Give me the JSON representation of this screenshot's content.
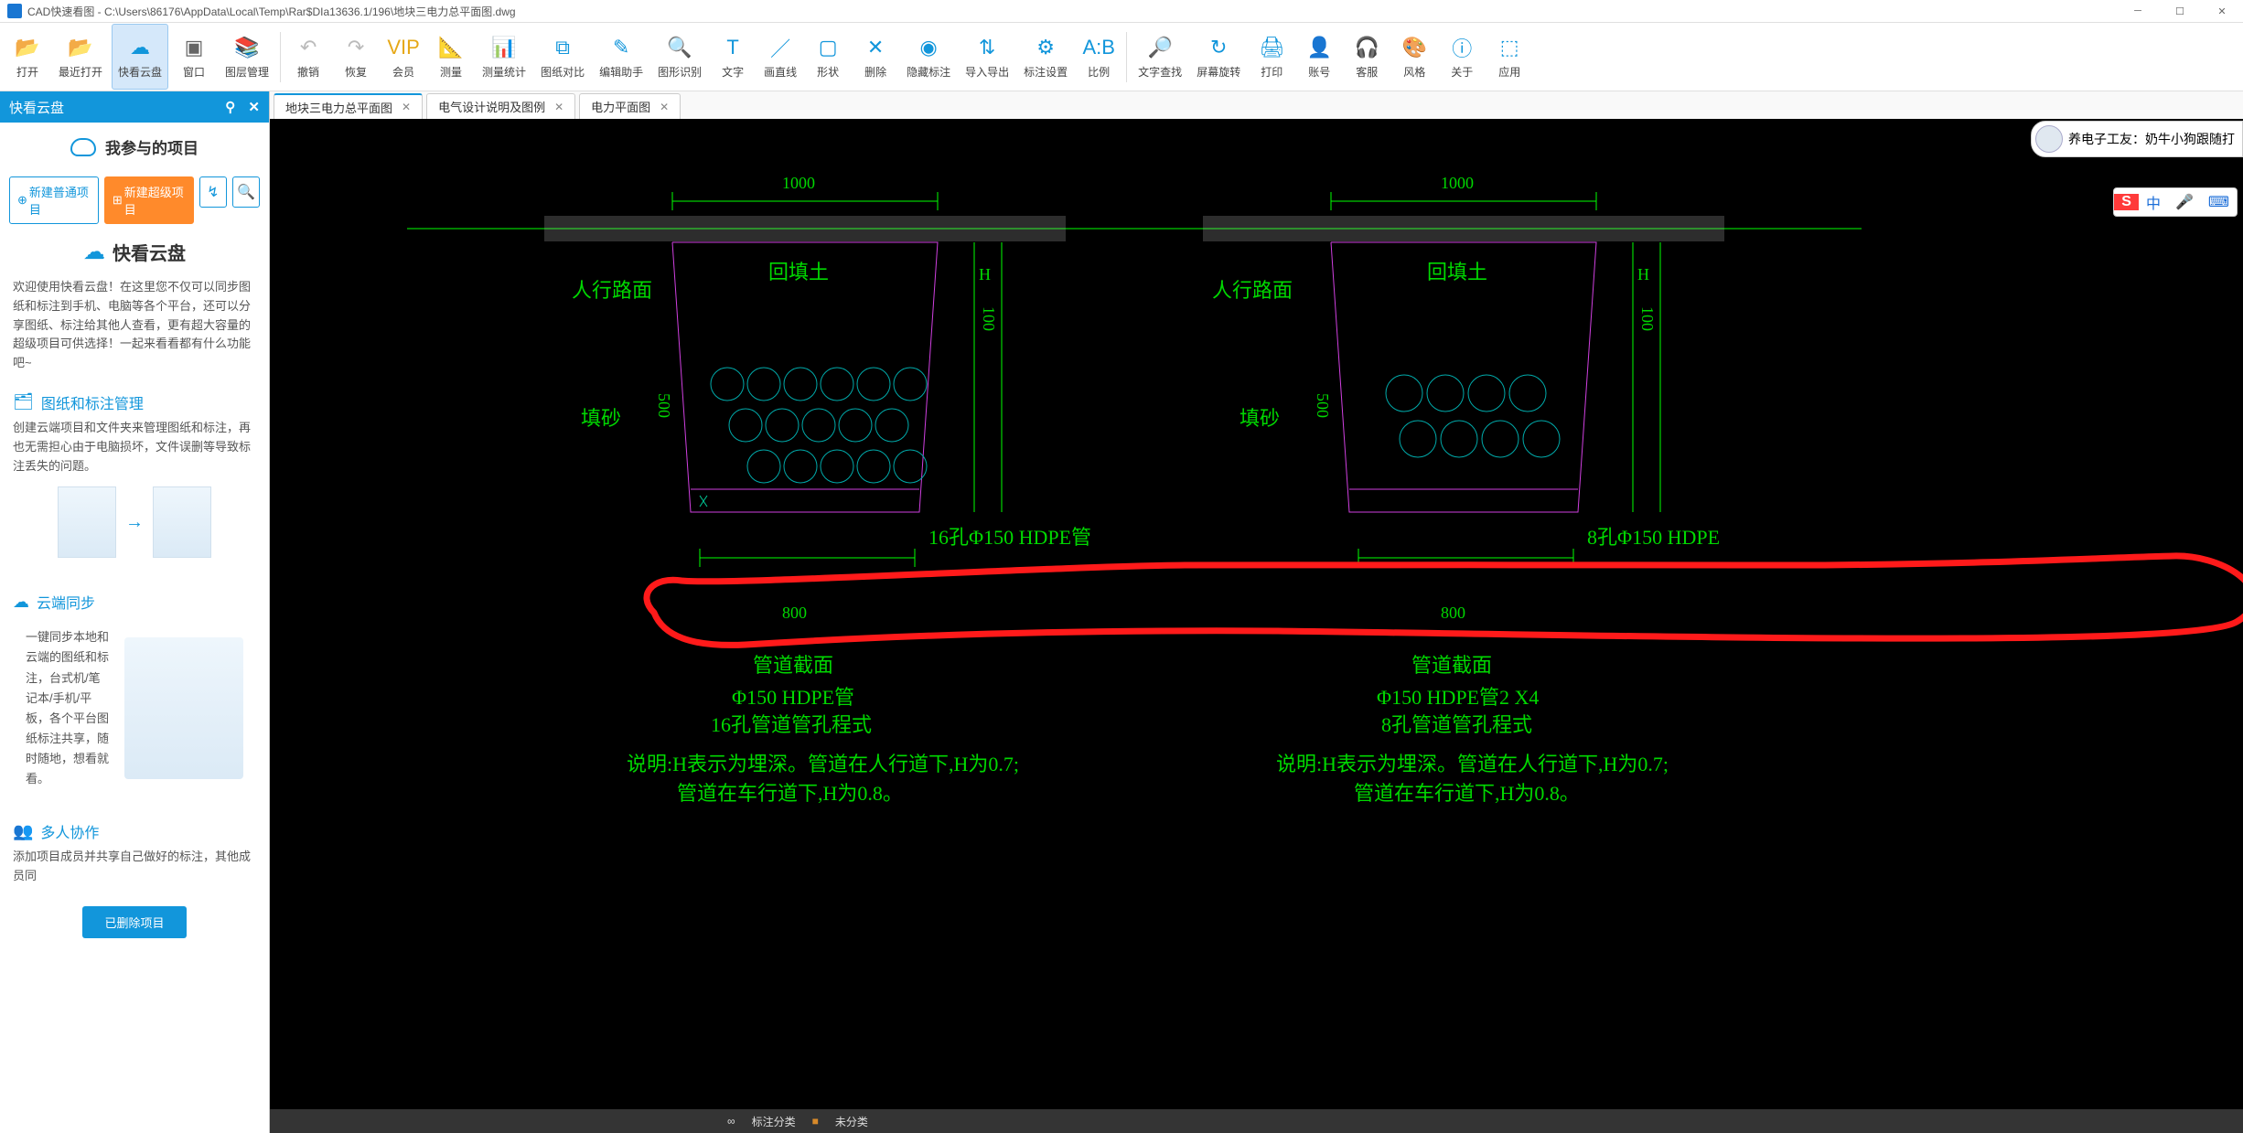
{
  "title": "CAD快速看图 - C:\\Users\\86176\\AppData\\Local\\Temp\\Rar$DIa13636.1/196\\地块三电力总平面图.dwg",
  "wincontrols": {
    "min": "─",
    "max": "☐",
    "close": "✕"
  },
  "toolbar": [
    {
      "label": "打开",
      "icon": "📂",
      "color": "#1296db"
    },
    {
      "label": "最近打开",
      "icon": "📂",
      "color": "#1296db"
    },
    {
      "label": "快看云盘",
      "icon": "☁",
      "color": "#1296db",
      "hl": true
    },
    {
      "label": "窗口",
      "icon": "▣",
      "color": "#666"
    },
    {
      "label": "图层管理",
      "icon": "📚",
      "color": "#1296db"
    },
    {
      "sep": true
    },
    {
      "label": "撤销",
      "icon": "↶",
      "color": "#bbb"
    },
    {
      "label": "恢复",
      "icon": "↷",
      "color": "#bbb"
    },
    {
      "label": "会员",
      "icon": "VIP",
      "color": "#e6a817"
    },
    {
      "label": "测量",
      "icon": "📐",
      "color": "#1296db"
    },
    {
      "label": "测量统计",
      "icon": "📊",
      "color": "#1296db"
    },
    {
      "label": "图纸对比",
      "icon": "⧉",
      "color": "#1296db"
    },
    {
      "label": "编辑助手",
      "icon": "✎",
      "color": "#1296db"
    },
    {
      "label": "图形识别",
      "icon": "🔍",
      "color": "#1296db"
    },
    {
      "label": "文字",
      "icon": "T",
      "color": "#1296db"
    },
    {
      "label": "画直线",
      "icon": "／",
      "color": "#1296db"
    },
    {
      "label": "形状",
      "icon": "▢",
      "color": "#1296db"
    },
    {
      "label": "删除",
      "icon": "✕",
      "color": "#1296db"
    },
    {
      "label": "隐藏标注",
      "icon": "◉",
      "color": "#1296db"
    },
    {
      "label": "导入导出",
      "icon": "⇅",
      "color": "#1296db"
    },
    {
      "label": "标注设置",
      "icon": "⚙",
      "color": "#1296db"
    },
    {
      "label": "比例",
      "icon": "A:B",
      "color": "#1296db"
    },
    {
      "sep": true
    },
    {
      "label": "文字查找",
      "icon": "🔎",
      "color": "#1296db"
    },
    {
      "label": "屏幕旋转",
      "icon": "↻",
      "color": "#1296db"
    },
    {
      "label": "打印",
      "icon": "🖨",
      "color": "#1296db"
    },
    {
      "label": "账号",
      "icon": "👤",
      "color": "#1296db"
    },
    {
      "label": "客服",
      "icon": "🎧",
      "color": "#1296db"
    },
    {
      "label": "风格",
      "icon": "🎨",
      "color": "#1296db"
    },
    {
      "label": "关于",
      "icon": "ⓘ",
      "color": "#1296db"
    },
    {
      "label": "应用",
      "icon": "⬚",
      "color": "#1296db"
    }
  ],
  "sidepanel": {
    "title": "快看云盘",
    "projecttitle": "我参与的项目",
    "newnormal": "新建普通项目",
    "newsuper": "新建超级项目",
    "brand": "快看云盘",
    "welcome": "欢迎使用快看云盘！在这里您不仅可以同步图纸和标注到手机、电脑等各个平台，还可以分享图纸、标注给其他人查看，更有超大容量的超级项目可供选择！一起来看看都有什么功能吧~",
    "sections": [
      {
        "title": "图纸和标注管理",
        "icon": "🗂",
        "desc": "创建云端项目和文件夹来管理图纸和标注，再也无需担心由于电脑损坏，文件误删等导致标注丢失的问题。"
      },
      {
        "title": "云端同步",
        "icon": "☁",
        "desc": "一键同步本地和云端的图纸和标注，台式机/笔记本/手机/平板，各个平台图纸标注共享，随时随地，想看就看。"
      },
      {
        "title": "多人协作",
        "icon": "👥",
        "desc": "添加项目成员并共享自己做好的标注，其他成员同"
      }
    ],
    "deletebutton": "已删除项目"
  },
  "tabs": [
    {
      "label": "地块三电力总平面图",
      "active": true
    },
    {
      "label": "电气设计说明及图例",
      "active": false
    },
    {
      "label": "电力平面图",
      "active": false
    }
  ],
  "drawing": {
    "left": {
      "top_label": "人行路面",
      "dim_top": "1000",
      "fill_label": "回填土",
      "sand_label": "填砂",
      "dim_h": "H",
      "dim_100": "100",
      "dim_500": "500",
      "pipe_label": "16孔Φ150 HDPE管",
      "dim_bottom": "800",
      "t1": "管道截面",
      "t2": "Φ150 HDPE管",
      "t3": "16孔管道管孔程式",
      "d1": "说明:H表示为埋深。管道在人行道下,H为0.7;",
      "d2": "管道在车行道下,H为0.8。"
    },
    "right": {
      "top_label": "人行路面",
      "dim_top": "1000",
      "fill_label": "回填土",
      "sand_label": "填砂",
      "dim_h": "H",
      "dim_100": "100",
      "dim_500": "500",
      "pipe_label": "8孔Φ150 HDPE",
      "dim_bottom": "800",
      "t1": "管道截面",
      "t2": "Φ150 HDPE管2 X4",
      "t3": "8孔管道管孔程式",
      "d1": "说明:H表示为埋深。管道在人行道下,H为0.7;",
      "d2": "管道在车行道下,H为0.8。"
    }
  },
  "userbadge": "养电子工友：奶牛小狗跟随打",
  "ime": {
    "logo": "S",
    "lang": "中",
    "mic": "🎤",
    "kbd": "⌨"
  },
  "status": {
    "category": "标注分类",
    "uncat": "未分类"
  }
}
